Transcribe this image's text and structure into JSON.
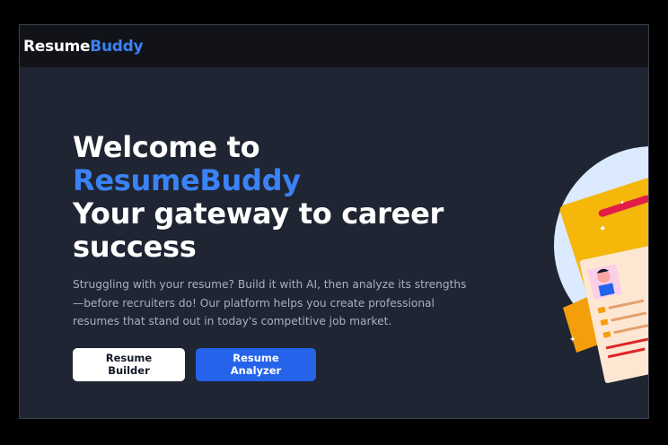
{
  "navbar": {
    "logo_part1": "Resume",
    "logo_part2": "Buddy"
  },
  "hero": {
    "line1": "Welcome to",
    "line2": "ResumeBuddy",
    "line3": "Your gateway to career success",
    "description": "Struggling with your resume? Build it with AI, then analyze its strengths—before recruiters do! Our platform helps you create professional resumes that stand out in today's competitive job market.",
    "buttons": {
      "builder": "Resume Builder",
      "analyzer": "Resume Analyzer"
    }
  },
  "colors": {
    "background": "#1f2532",
    "navbar": "#111318",
    "accent": "#3b82f6",
    "primary_button": "#2563eb"
  }
}
